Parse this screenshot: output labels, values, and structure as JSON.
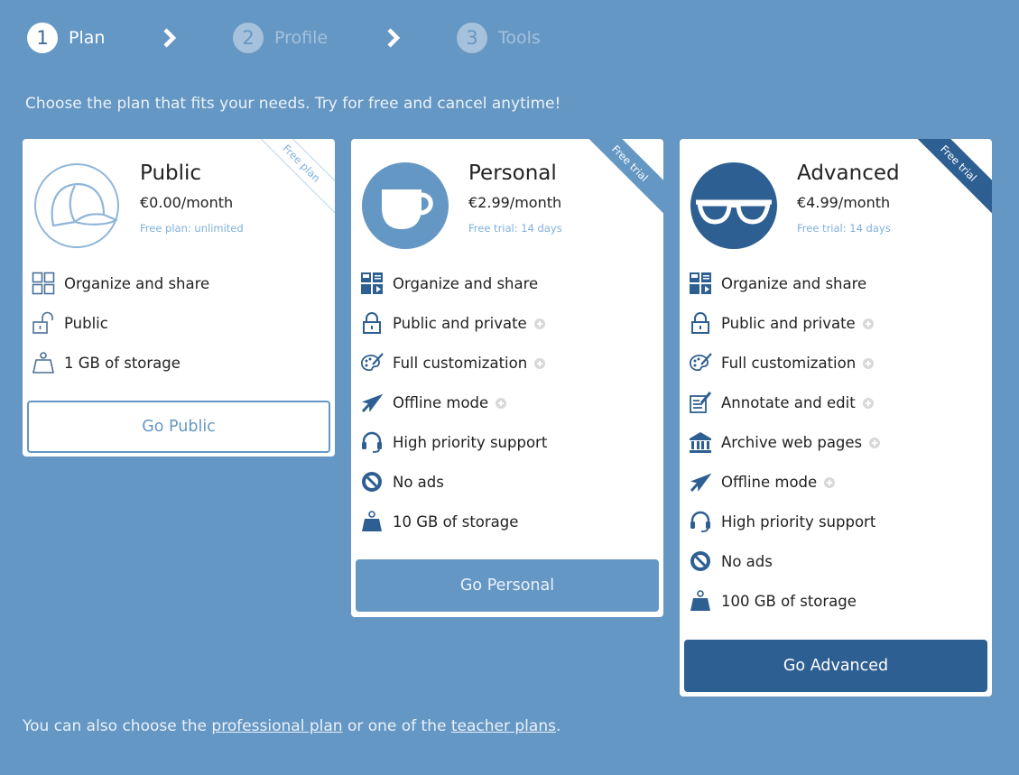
{
  "steps": [
    {
      "number": "1",
      "label": "Plan"
    },
    {
      "number": "2",
      "label": "Profile"
    },
    {
      "number": "3",
      "label": "Tools"
    }
  ],
  "intro": "Choose the plan that fits your needs. Try for free and cancel anytime!",
  "plans": [
    {
      "name": "Public",
      "price": "€0.00/month",
      "note": "Free plan: unlimited",
      "ribbon": "Free plan",
      "icon": "cap-icon",
      "features": [
        {
          "icon": "grid-icon",
          "label": "Organize and share",
          "info": false
        },
        {
          "icon": "unlocked-padlock-icon",
          "label": "Public",
          "info": false
        },
        {
          "icon": "weight-icon",
          "label": "1 GB of storage",
          "info": false
        }
      ],
      "button": "Go Public"
    },
    {
      "name": "Personal",
      "price": "€2.99/month",
      "note": "Free trial: 14 days",
      "ribbon": "Free trial",
      "icon": "cup-icon",
      "features": [
        {
          "icon": "media-grid-icon",
          "label": "Organize and share",
          "info": false
        },
        {
          "icon": "padlock-icon",
          "label": "Public and private",
          "info": true
        },
        {
          "icon": "palette-icon",
          "label": "Full customization",
          "info": true
        },
        {
          "icon": "airplane-icon",
          "label": "Offline mode",
          "info": true
        },
        {
          "icon": "headset-icon",
          "label": "High priority support",
          "info": false
        },
        {
          "icon": "no-ads-icon",
          "label": "No ads",
          "info": false
        },
        {
          "icon": "weight-icon",
          "label": "10 GB of storage",
          "info": false
        }
      ],
      "button": "Go Personal"
    },
    {
      "name": "Advanced",
      "price": "€4.99/month",
      "note": "Free trial: 14 days",
      "ribbon": "Free trial",
      "icon": "glasses-icon",
      "features": [
        {
          "icon": "media-grid-icon",
          "label": "Organize and share",
          "info": false
        },
        {
          "icon": "padlock-icon",
          "label": "Public and private",
          "info": true
        },
        {
          "icon": "palette-icon",
          "label": "Full customization",
          "info": true
        },
        {
          "icon": "annotate-icon",
          "label": "Annotate and edit",
          "info": true
        },
        {
          "icon": "archive-icon",
          "label": "Archive web pages",
          "info": true
        },
        {
          "icon": "airplane-icon",
          "label": "Offline mode",
          "info": true
        },
        {
          "icon": "headset-icon",
          "label": "High priority support",
          "info": false
        },
        {
          "icon": "no-ads-icon",
          "label": "No ads",
          "info": false
        },
        {
          "icon": "weight-icon",
          "label": "100 GB of storage",
          "info": false
        }
      ],
      "button": "Go Advanced"
    }
  ],
  "footer": {
    "prefix": "You can also choose the",
    "link1": "professional plan",
    "middle": "or one of the",
    "link2": "teacher plans",
    "suffix": "."
  },
  "colors": {
    "background": "#6597c4",
    "dark_accent": "#2e5f92",
    "light_text": "#7fb0dc"
  }
}
